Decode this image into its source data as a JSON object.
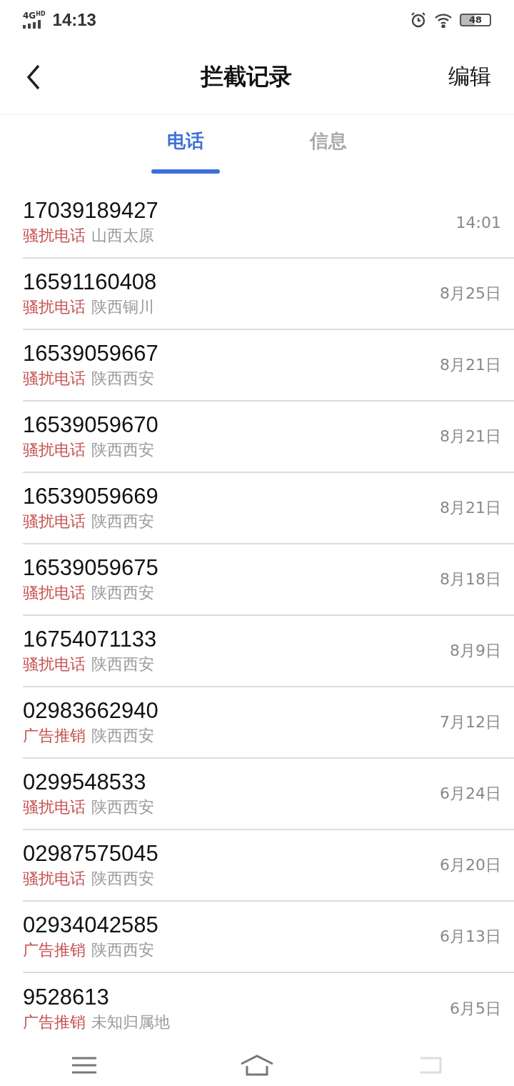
{
  "status_bar": {
    "network": "4G",
    "network_sub": "HD",
    "time": "14:13",
    "battery": "48"
  },
  "header": {
    "title": "拦截记录",
    "action": "编辑"
  },
  "tabs": [
    {
      "label": "电话",
      "selected": true
    },
    {
      "label": "信息",
      "selected": false
    }
  ],
  "records": [
    {
      "number": "17039189427",
      "tag": "骚扰电话",
      "location": "山西太原",
      "time": "14:01"
    },
    {
      "number": "16591160408",
      "tag": "骚扰电话",
      "location": "陕西铜川",
      "time": "8月25日"
    },
    {
      "number": "16539059667",
      "tag": "骚扰电话",
      "location": "陕西西安",
      "time": "8月21日"
    },
    {
      "number": "16539059670",
      "tag": "骚扰电话",
      "location": "陕西西安",
      "time": "8月21日"
    },
    {
      "number": "16539059669",
      "tag": "骚扰电话",
      "location": "陕西西安",
      "time": "8月21日"
    },
    {
      "number": "16539059675",
      "tag": "骚扰电话",
      "location": "陕西西安",
      "time": "8月18日"
    },
    {
      "number": "16754071133",
      "tag": "骚扰电话",
      "location": "陕西西安",
      "time": "8月9日"
    },
    {
      "number": "02983662940",
      "tag": "广告推销",
      "location": "陕西西安",
      "time": "7月12日"
    },
    {
      "number": "0299548533",
      "tag": "骚扰电话",
      "location": "陕西西安",
      "time": "6月24日"
    },
    {
      "number": "02987575045",
      "tag": "骚扰电话",
      "location": "陕西西安",
      "time": "6月20日"
    },
    {
      "number": "02934042585",
      "tag": "广告推销",
      "location": "陕西西安",
      "time": "6月13日"
    },
    {
      "number": "9528613",
      "tag": "广告推销",
      "location": "未知归属地",
      "time": "6月5日"
    }
  ]
}
